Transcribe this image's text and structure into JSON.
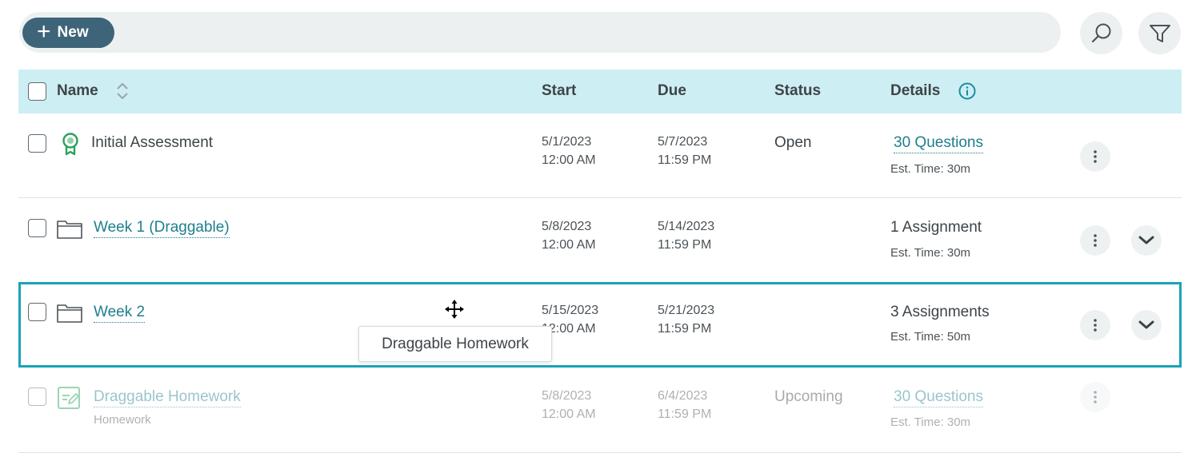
{
  "toolbar": {
    "new_label": "New",
    "search_icon": "search-icon",
    "filter_icon": "filter-icon"
  },
  "table": {
    "columns": {
      "name": "Name",
      "start": "Start",
      "due": "Due",
      "status": "Status",
      "details": "Details"
    },
    "rows": [
      {
        "icon": "award-ribbon-icon",
        "name": "Initial Assessment",
        "start_date": "5/1/2023",
        "start_time": "12:00 AM",
        "due_date": "5/7/2023",
        "due_time": "11:59 PM",
        "status": "Open",
        "details_main": "30 Questions",
        "details_est": "Est. Time: 30m"
      },
      {
        "icon": "folder-icon",
        "name": "Week 1 (Draggable)",
        "start_date": "5/8/2023",
        "start_time": "12:00 AM",
        "due_date": "5/14/2023",
        "due_time": "11:59 PM",
        "status": "",
        "details_main": "1 Assignment",
        "details_est": "Est. Time: 30m"
      },
      {
        "icon": "folder-icon",
        "name": "Week 2",
        "start_date": "5/15/2023",
        "start_time": "12:00 AM",
        "due_date": "5/21/2023",
        "due_time": "11:59 PM",
        "status": "",
        "details_main": "3 Assignments",
        "details_est": "Est. Time: 50m"
      },
      {
        "icon": "homework-icon",
        "name": "Draggable Homework",
        "subtitle": "Homework",
        "start_date": "5/8/2023",
        "start_time": "12:00 AM",
        "due_date": "6/4/2023",
        "due_time": "11:59 PM",
        "status": "Upcoming",
        "details_main": "30 Questions",
        "details_est": "Est. Time: 30m"
      }
    ]
  },
  "drag": {
    "tooltip": "Draggable Homework",
    "cursor_icon": "move-cursor-icon"
  },
  "colors": {
    "accent": "#3e6479",
    "header_bg": "#cdeef2",
    "link": "#1e7f8d",
    "selection": "#19a3b7"
  }
}
